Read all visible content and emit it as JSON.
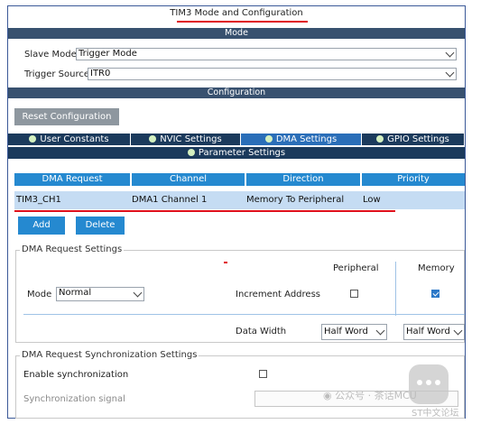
{
  "window": {
    "title": "TIM3 Mode and Configuration"
  },
  "mode_section": {
    "header": "Mode",
    "slave_mode_label": "Slave Mode",
    "slave_mode_value": "Trigger Mode",
    "trigger_source_label": "Trigger Source",
    "trigger_source_value": "ITR0"
  },
  "config_section": {
    "header": "Configuration",
    "reset_button": "Reset Configuration",
    "tabs": [
      {
        "label": "User Constants"
      },
      {
        "label": "NVIC Settings"
      },
      {
        "label": "DMA Settings",
        "active": true
      },
      {
        "label": "GPIO Settings"
      }
    ],
    "subtab": "Parameter Settings"
  },
  "dma_table": {
    "headers": [
      "DMA Request",
      "Channel",
      "Direction",
      "Priority"
    ],
    "rows": [
      {
        "request": "TIM3_CH1",
        "channel": "DMA1 Channel 1",
        "direction": "Memory To Peripheral",
        "priority": "Low"
      }
    ]
  },
  "actions": {
    "add": "Add",
    "delete": "Delete"
  },
  "request_settings": {
    "title": "DMA Request Settings",
    "peripheral_header": "Peripheral",
    "memory_header": "Memory",
    "mode_label": "Mode",
    "mode_value": "Normal",
    "increment_label": "Increment Address",
    "increment_peripheral": false,
    "increment_memory": true,
    "data_width_label": "Data Width",
    "peripheral_width": "Half Word",
    "memory_width": "Half Word"
  },
  "sync_settings": {
    "title": "DMA Request Synchronization Settings",
    "enable_label": "Enable synchronization",
    "enable_checked": false,
    "signal_label": "Synchronization signal"
  },
  "watermark": {
    "text": "公众号 · 茶话MCU",
    "sub": "ST中文论坛"
  },
  "colors": {
    "band": "#38516f",
    "tab": "#1b3a5c",
    "accent": "#2589d0",
    "selected_row": "#c5dcf3",
    "highlight": "#e0101c"
  }
}
